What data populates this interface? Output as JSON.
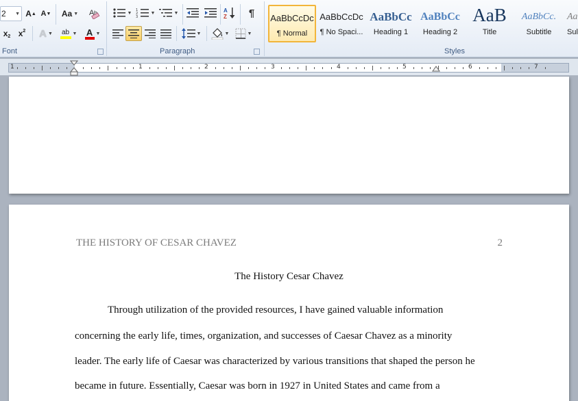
{
  "ribbon": {
    "font": {
      "label": "Font",
      "size_value": "2",
      "grow_glyph": "A",
      "shrink_glyph": "A",
      "change_case": "Aa",
      "subscript": "x",
      "superscript": "x",
      "highlight_glyph": "ab",
      "font_color_glyph": "A",
      "text_effects_glyph": "A",
      "highlight_color": "#ffff00",
      "font_color": "#e00000"
    },
    "paragraph": {
      "label": "Paragraph",
      "sort_glyph": "A",
      "pilcrow": "¶"
    },
    "styles": {
      "label": "Styles",
      "items": [
        {
          "sample": "AaBbCcDc",
          "name": "¶ Normal",
          "selected": true
        },
        {
          "sample": "AaBbCcDc",
          "name": "¶ No Spaci..."
        },
        {
          "sample": "AaBbCc",
          "name": "Heading 1"
        },
        {
          "sample": "AaBbCc",
          "name": "Heading 2"
        },
        {
          "sample": "AaB",
          "name": "Title"
        },
        {
          "sample": "AaBbCc.",
          "name": "Subtitle"
        },
        {
          "sample": "Aa",
          "name": "Sul"
        }
      ]
    }
  },
  "ruler": {
    "numbers": [
      "1",
      "1",
      "2",
      "3",
      "4",
      "5",
      "6",
      "7"
    ]
  },
  "document": {
    "running_head": "THE HISTORY OF CESAR CHAVEZ",
    "page_number": "2",
    "title": "The History Cesar Chavez",
    "lines": [
      "Through utilization of the provided resources, I have gained valuable information",
      "concerning the early life, times, organization, and successes of Caesar Chavez as a minority",
      "leader. The early life of Caesar was characterized by various transitions that shaped the person he",
      "became in future. Essentially, Caesar was born in 1927 in United States and came from a"
    ]
  }
}
